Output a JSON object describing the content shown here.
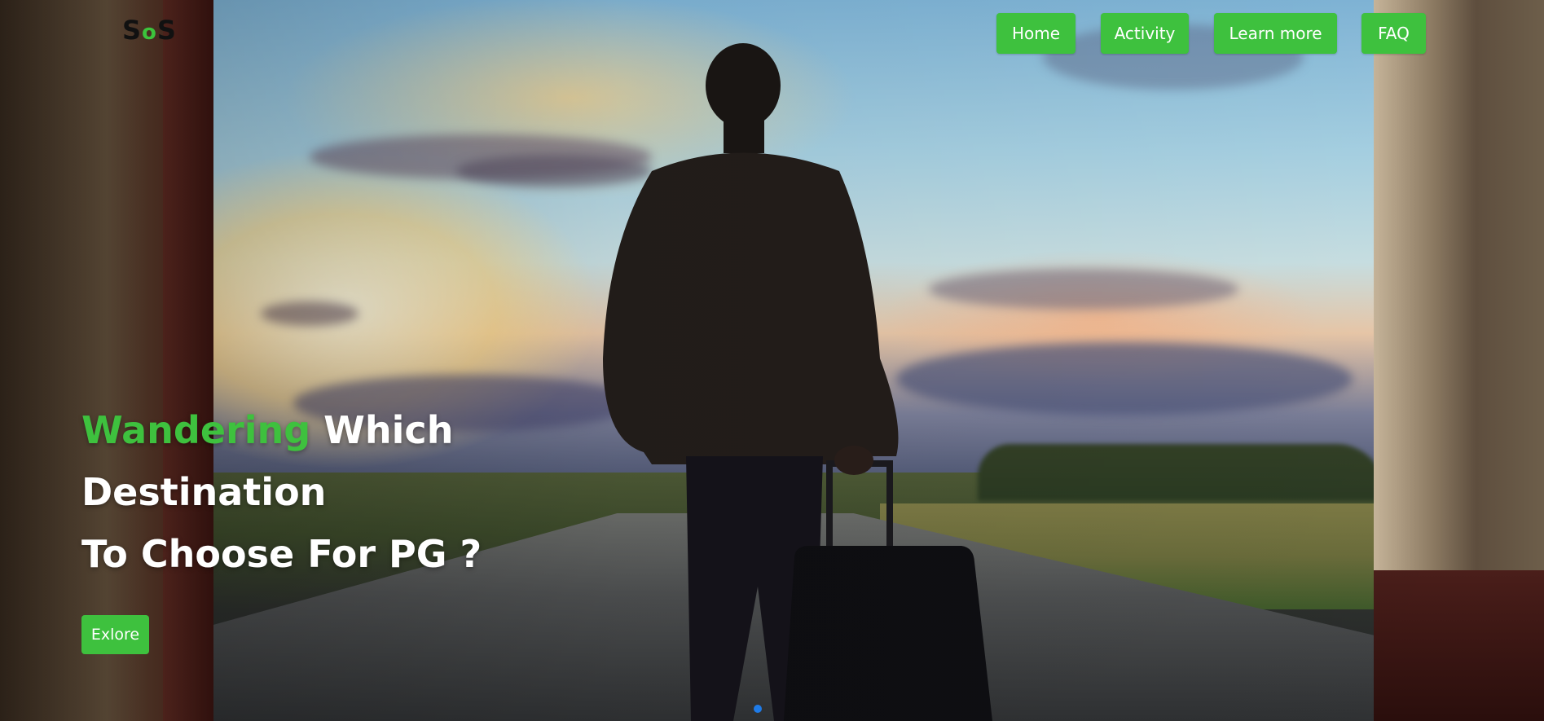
{
  "brand": {
    "logo_left": "S",
    "logo_mid": "o",
    "logo_right": "S",
    "accent_color": "#3ec13e"
  },
  "nav": {
    "items": [
      {
        "label": "Home"
      },
      {
        "label": "Activity"
      },
      {
        "label": "Learn more"
      },
      {
        "label": "FAQ"
      }
    ]
  },
  "hero": {
    "headline_accent": "Wandering",
    "headline_rest": " Which",
    "headline_line2": "Destination",
    "headline_line3": "To Choose For PG ?",
    "cta_label": "Exlore",
    "background_image": "traveler-with-suitcase-sunset"
  },
  "carousel": {
    "indicator_color": "#1e7be8",
    "active_slide": 1,
    "slide_count": 1
  }
}
